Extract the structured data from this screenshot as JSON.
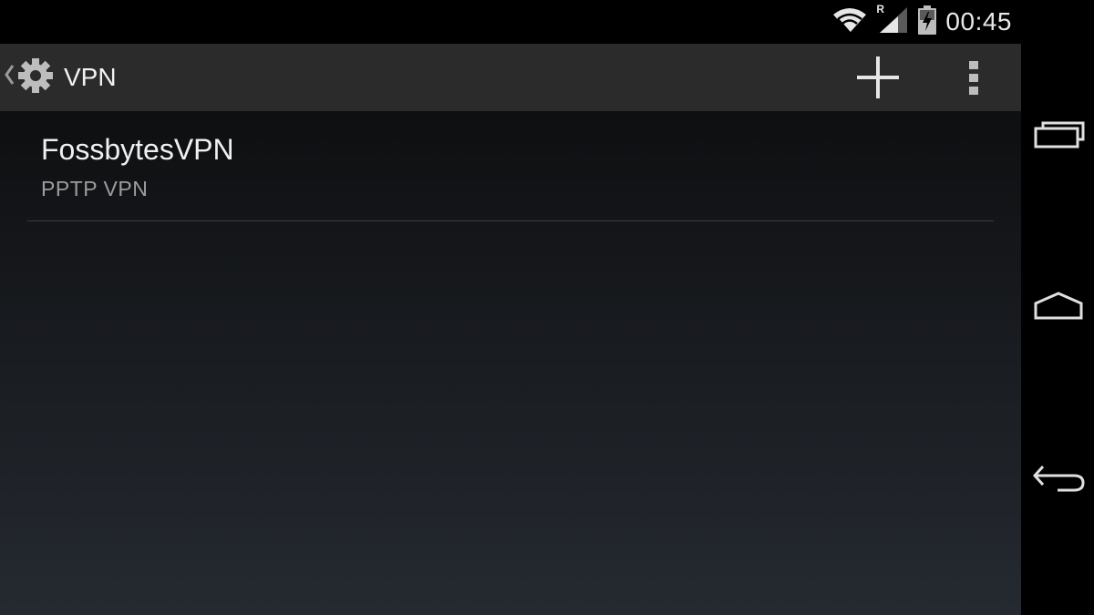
{
  "status_bar": {
    "icons": [
      "wifi-icon",
      "roaming-signal-icon",
      "battery-charging-icon"
    ],
    "roaming_label": "R",
    "time": "00:45"
  },
  "action_bar": {
    "title": "VPN",
    "app_icon": "settings-gear-icon",
    "actions": [
      "add-icon",
      "overflow-menu-icon"
    ]
  },
  "vpn_list": [
    {
      "name": "FossbytesVPN",
      "type": "PPTP VPN"
    }
  ],
  "nav_bar": {
    "buttons": [
      "recent-apps-icon",
      "home-icon",
      "back-icon"
    ]
  },
  "colors": {
    "action_bar_bg": "#2b2b2b",
    "content_bg_top": "#0e0f11",
    "content_bg_bottom": "#252a31",
    "divider": "#3a3d42"
  }
}
